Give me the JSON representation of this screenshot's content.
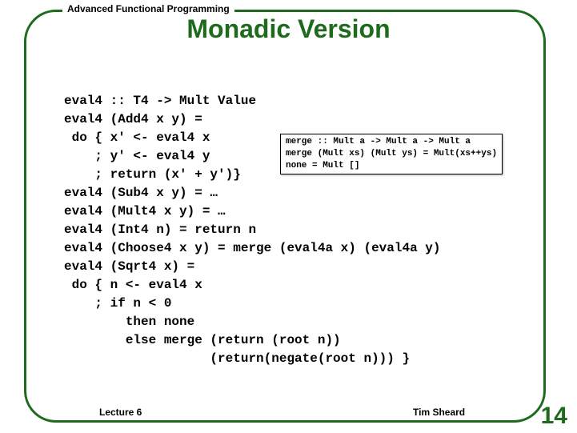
{
  "header": "Advanced Functional Programming",
  "title": "Monadic Version",
  "code": "eval4 :: T4 -> Mult Value\neval4 (Add4 x y) =\n do { x' <- eval4 x\n    ; y' <- eval4 y\n    ; return (x' + y')}\neval4 (Sub4 x y) = …\neval4 (Mult4 x y) = …\neval4 (Int4 n) = return n\neval4 (Choose4 x y) = merge (eval4a x) (eval4a y)\neval4 (Sqrt4 x) =\n do { n <- eval4 x\n    ; if n < 0\n        then none\n        else merge (return (root n))\n                   (return(negate(root n))) }",
  "inset": "merge :: Mult a -> Mult a -> Mult a\nmerge (Mult xs) (Mult ys) = Mult(xs++ys)\nnone = Mult []",
  "footer_left": "Lecture 6",
  "footer_right": "Tim Sheard",
  "page_number": "14"
}
